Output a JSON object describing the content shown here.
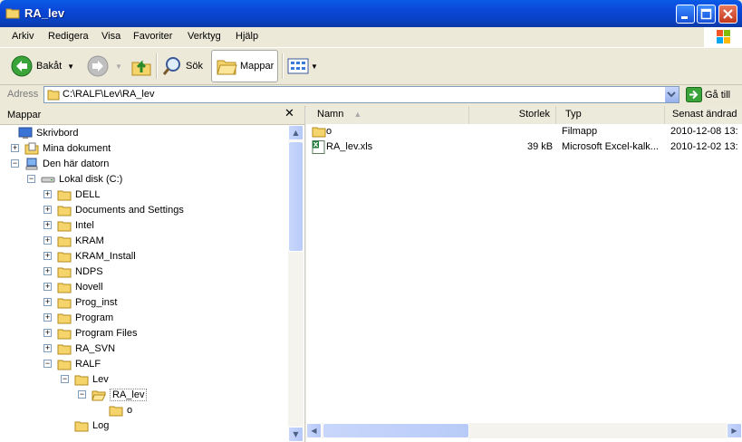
{
  "window": {
    "title": "RA_lev"
  },
  "menu": [
    "Arkiv",
    "Redigera",
    "Visa",
    "Favoriter",
    "Verktyg",
    "Hjälp"
  ],
  "toolbar": {
    "back": "Bakåt",
    "search": "Sök",
    "folders": "Mappar"
  },
  "address": {
    "label": "Adress",
    "value": "C:\\RALF\\Lev\\RA_lev",
    "go": "Gå till"
  },
  "folders_pane": {
    "title": "Mappar",
    "tree": [
      {
        "label": "Skrivbord",
        "icon": "desktop-icon"
      },
      {
        "label": "Mina dokument",
        "icon": "my-documents-icon",
        "exp": "+"
      },
      {
        "label": "Den här datorn",
        "icon": "my-computer-icon",
        "exp": "−"
      },
      {
        "label": "Lokal disk (C:)",
        "icon": "drive-icon",
        "exp": "−"
      },
      {
        "label": "DELL",
        "icon": "folder-icon",
        "exp": "+"
      },
      {
        "label": "Documents and Settings",
        "icon": "folder-icon",
        "exp": "+"
      },
      {
        "label": "Intel",
        "icon": "folder-icon",
        "exp": "+"
      },
      {
        "label": "KRAM",
        "icon": "folder-icon",
        "exp": "+"
      },
      {
        "label": "KRAM_Install",
        "icon": "folder-icon",
        "exp": "+"
      },
      {
        "label": "NDPS",
        "icon": "folder-icon",
        "exp": "+"
      },
      {
        "label": "Novell",
        "icon": "folder-icon",
        "exp": "+"
      },
      {
        "label": "Prog_inst",
        "icon": "folder-icon",
        "exp": "+"
      },
      {
        "label": "Program",
        "icon": "folder-icon",
        "exp": "+"
      },
      {
        "label": "Program Files",
        "icon": "folder-icon",
        "exp": "+"
      },
      {
        "label": "RA_SVN",
        "icon": "folder-icon",
        "exp": "+"
      },
      {
        "label": "RALF",
        "icon": "folder-icon",
        "exp": "−"
      },
      {
        "label": "Lev",
        "icon": "folder-icon",
        "exp": "−"
      },
      {
        "label": "RA_lev",
        "icon": "open-folder-icon",
        "exp": "−",
        "selected": true
      },
      {
        "label": "o",
        "icon": "folder-icon"
      },
      {
        "label": "Log",
        "icon": "folder-icon"
      }
    ]
  },
  "list": {
    "columns": [
      "Namn",
      "Storlek",
      "Typ",
      "Senast ändrad"
    ],
    "rows": [
      {
        "name": "o",
        "size": "",
        "type": "Filmapp",
        "modified": "2010-12-08 13:",
        "icon": "folder-icon"
      },
      {
        "name": "RA_lev.xls",
        "size": "39 kB",
        "type": "Microsoft Excel-kalk...",
        "modified": "2010-12-02 13:",
        "icon": "excel-file-icon"
      }
    ]
  },
  "colors": {
    "titlebar": "#0a46d6",
    "selection": "#316ac5",
    "folder": "#f5d56b"
  }
}
